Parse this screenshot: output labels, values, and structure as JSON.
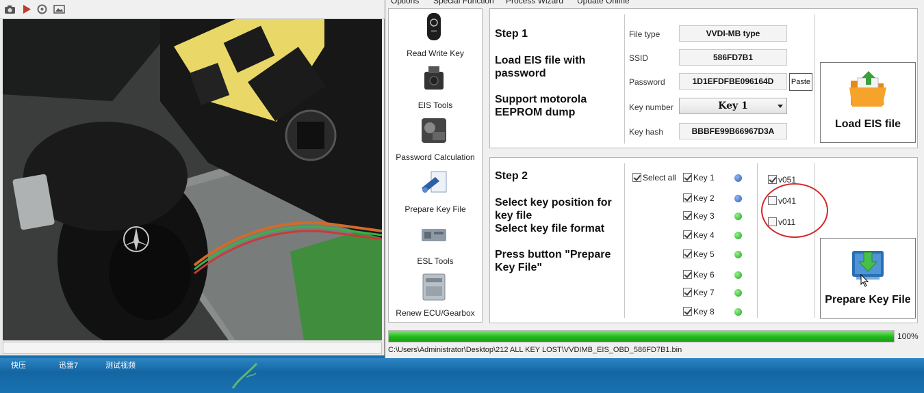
{
  "player": {
    "toolbar_icons": [
      "camera-icon",
      "play-icon",
      "settings-icon",
      "image-icon"
    ]
  },
  "app": {
    "menu": [
      "Options",
      "Special Function",
      "Process Wizard",
      "Update Online"
    ],
    "sidebar": [
      {
        "icon": "smart-key-icon",
        "label": "Read Write Key"
      },
      {
        "icon": "eis-icon",
        "label": "EIS Tools"
      },
      {
        "icon": "password-calc-icon",
        "label": "Password Calculation"
      },
      {
        "icon": "key-file-icon",
        "label": "Prepare Key File"
      },
      {
        "icon": "esl-icon",
        "label": "ESL Tools"
      },
      {
        "icon": "ecu-icon",
        "label": "Renew ECU/Gearbox"
      }
    ],
    "step1": {
      "title": "Step 1",
      "desc1": "Load EIS file with password",
      "desc2": "Support motorola EEPROM dump",
      "file_type_label": "File type",
      "file_type": "VVDI-MB type",
      "ssid_label": "SSID",
      "ssid": "586FD7B1",
      "password_label": "Password",
      "password": "1D1EFDFBE096164D",
      "paste_label": "Paste",
      "key_number_label": "Key number",
      "key_number": "Key 1",
      "key_hash_label": "Key hash",
      "key_hash": "BBBFE99B66967D3A",
      "load_button": "Load EIS file"
    },
    "step2": {
      "title": "Step 2",
      "desc1": "Select key position for key file",
      "desc2": "Select key file format",
      "desc3": "Press button \"Prepare Key File\"",
      "select_all": "Select all",
      "keys": [
        {
          "label": "Key 1",
          "checked": true,
          "status": "blue"
        },
        {
          "label": "Key 2",
          "checked": true,
          "status": "blue"
        },
        {
          "label": "Key 3",
          "checked": true,
          "status": "green"
        },
        {
          "label": "Key 4",
          "checked": true,
          "status": "green"
        },
        {
          "label": "Key 5",
          "checked": true,
          "status": "green"
        },
        {
          "label": "Key 6",
          "checked": true,
          "status": "green"
        },
        {
          "label": "Key 7",
          "checked": true,
          "status": "green"
        },
        {
          "label": "Key 8",
          "checked": true,
          "status": "green"
        }
      ],
      "formats": [
        {
          "label": "v051",
          "checked": true
        },
        {
          "label": "v041",
          "checked": false
        },
        {
          "label": "v011",
          "checked": false
        }
      ],
      "prepare_button": "Prepare Key File"
    },
    "progress_fraction": 1.0,
    "progress_text": "100%",
    "file_path": "C:\\Users\\Administrator\\Desktop\\212 ALL KEY LOST\\VVDIMB_EIS_OBD_586FD7B1.bin"
  },
  "taskbar": {
    "items": [
      "快压",
      "迅雷7",
      "测试视频"
    ]
  },
  "colors": {
    "progress": "#22b81d",
    "highlight_ring": "#d7262b",
    "taskbar": "#1a72b1"
  }
}
